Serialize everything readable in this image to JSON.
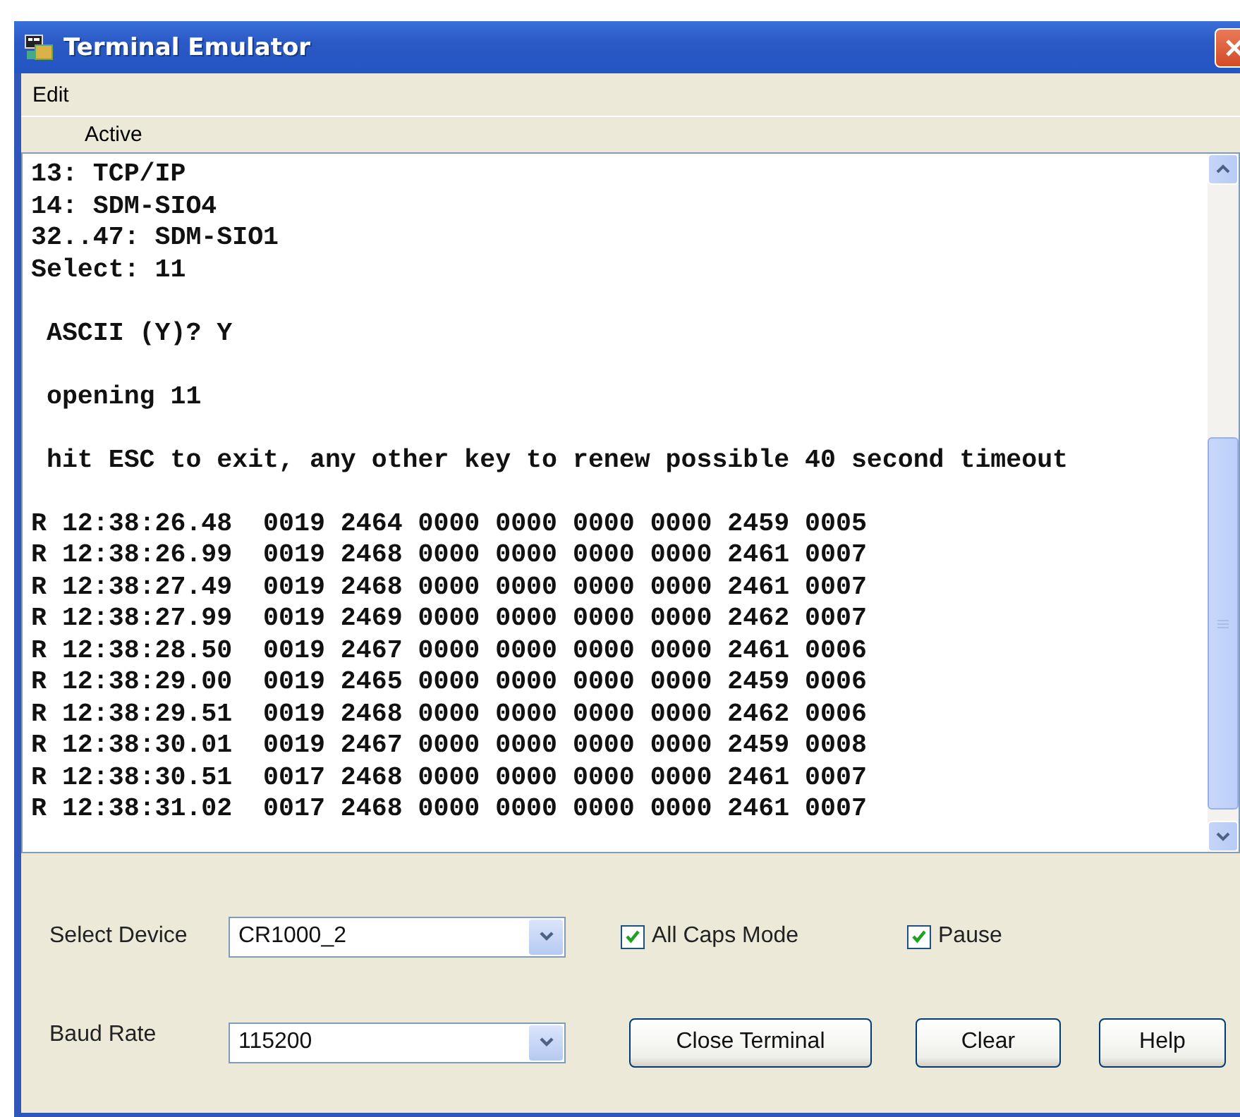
{
  "window": {
    "title": "Terminal Emulator"
  },
  "menu": [
    {
      "label": "Edit"
    }
  ],
  "status_label": "Active",
  "terminal": {
    "blocks": [
      [
        "13: TCP/IP",
        "14: SDM-SIO4",
        "32..47: SDM-SIO1",
        "Select: 11"
      ],
      [
        " ASCII (Y)? Y"
      ],
      [
        " opening 11"
      ],
      [
        " hit ESC to exit, any other key to renew possible 40 second timeout"
      ],
      [
        "R 12:38:26.48  0019 2464 0000 0000 0000 0000 2459 0005",
        "R 12:38:26.99  0019 2468 0000 0000 0000 0000 2461 0007",
        "R 12:38:27.49  0019 2468 0000 0000 0000 0000 2461 0007",
        "R 12:38:27.99  0019 2469 0000 0000 0000 0000 2462 0007",
        "R 12:38:28.50  0019 2467 0000 0000 0000 0000 2461 0006",
        "R 12:38:29.00  0019 2465 0000 0000 0000 0000 2459 0006",
        "R 12:38:29.51  0019 2468 0000 0000 0000 0000 2462 0006",
        "R 12:38:30.01  0019 2467 0000 0000 0000 0000 2459 0008",
        "R 12:38:30.51  0017 2468 0000 0000 0000 0000 2461 0007",
        "R 12:38:31.02  0017 2468 0000 0000 0000 0000 2461 0007"
      ]
    ]
  },
  "controls": {
    "select_device": {
      "label": "Select Device",
      "value": "CR1000_2"
    },
    "baud_rate": {
      "label": "Baud Rate",
      "value": "115200"
    },
    "checkboxes": [
      {
        "label": "All Caps Mode",
        "checked": true
      },
      {
        "label": "Pause",
        "checked": true
      }
    ],
    "buttons": [
      "Close Terminal",
      "Clear",
      "Help"
    ]
  }
}
